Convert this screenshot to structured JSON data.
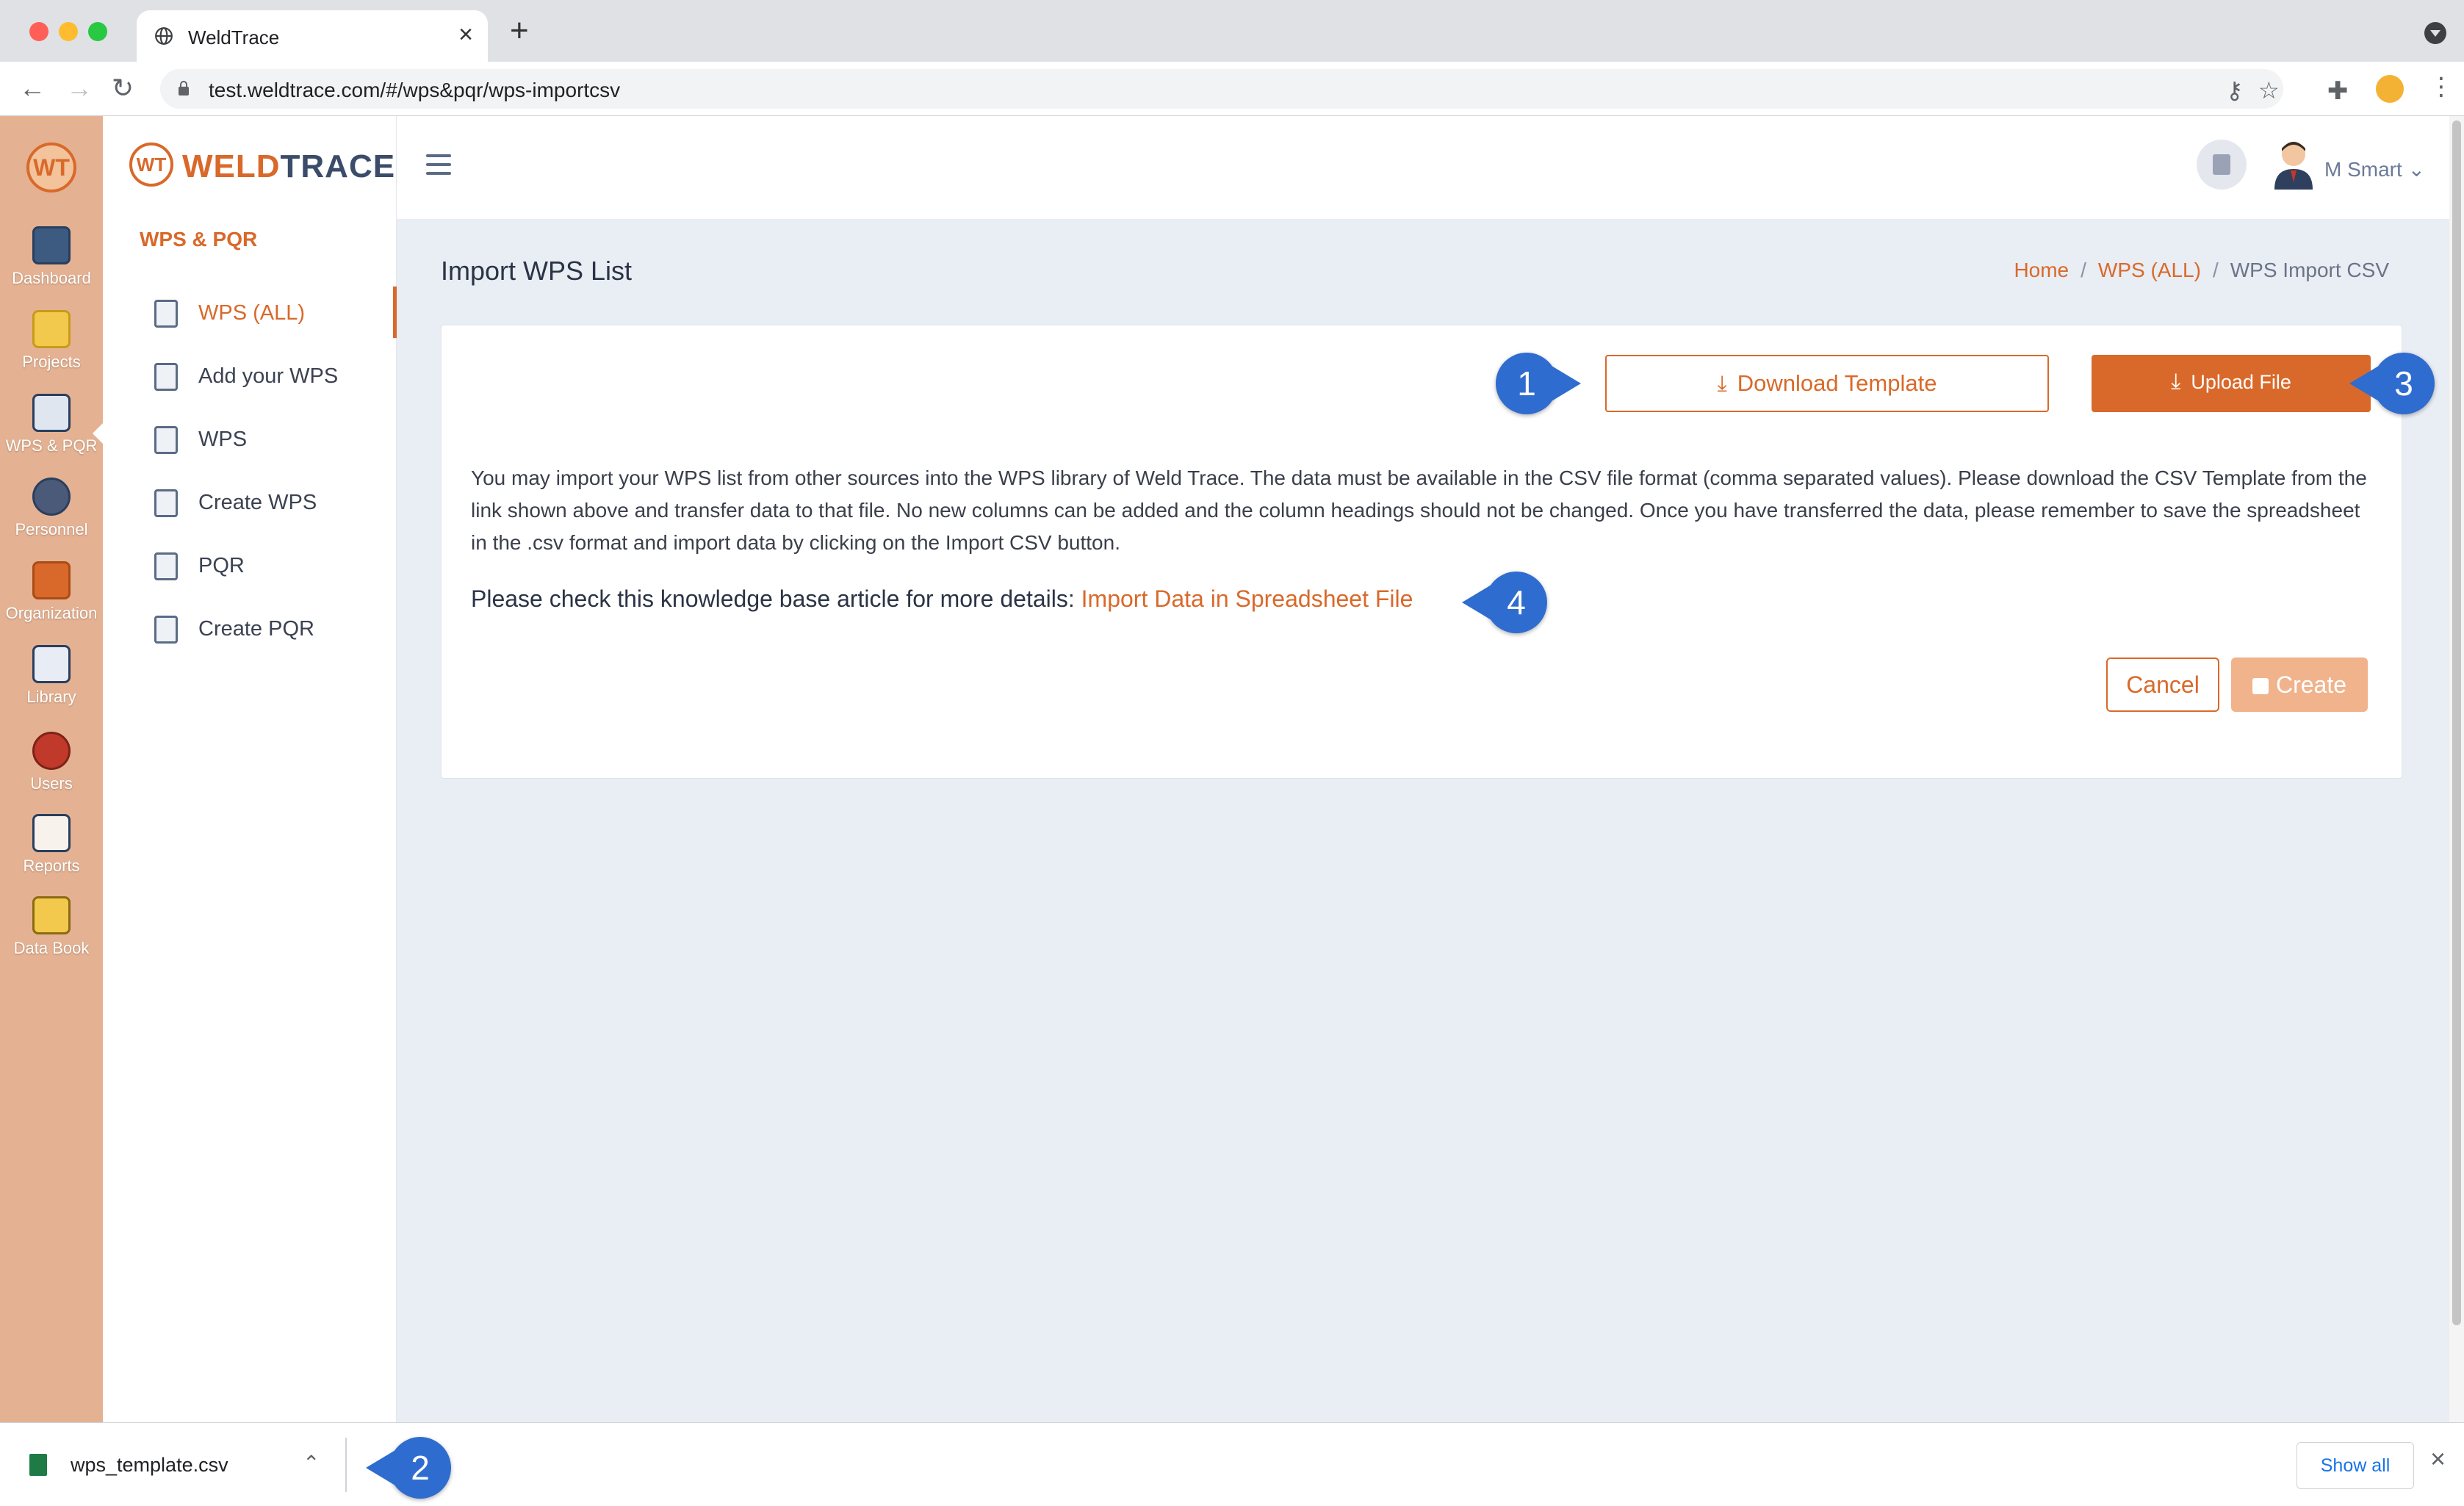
{
  "browser": {
    "tab_title": "WeldTrace",
    "new_tab": "+",
    "tab_close": "×",
    "url": "test.weldtrace.com/#/wps&pqr/wps-importcsv"
  },
  "rail": {
    "logo": "WT",
    "items": [
      {
        "label": "Dashboard",
        "icon": "dashboard-icon"
      },
      {
        "label": "Projects",
        "icon": "projects-icon"
      },
      {
        "label": "WPS & PQR",
        "icon": "wps-pqr-icon"
      },
      {
        "label": "Personnel",
        "icon": "personnel-icon"
      },
      {
        "label": "Organization",
        "icon": "organization-icon"
      },
      {
        "label": "Library",
        "icon": "library-icon"
      },
      {
        "label": "Users",
        "icon": "users-icon"
      },
      {
        "label": "Reports",
        "icon": "reports-icon"
      },
      {
        "label": "Data Book",
        "icon": "data-book-icon"
      }
    ],
    "active": "WPS & PQR"
  },
  "sidebar": {
    "brand_mark": "WT",
    "brand_weld": "WELD",
    "brand_trace": "TRACE",
    "section_title": "WPS & PQR",
    "items": [
      {
        "label": "WPS (ALL)"
      },
      {
        "label": "Add your WPS"
      },
      {
        "label": "WPS"
      },
      {
        "label": "Create WPS"
      },
      {
        "label": "PQR"
      },
      {
        "label": "Create PQR"
      }
    ],
    "active": "WPS (ALL)"
  },
  "topbar": {
    "user_name": "M Smart",
    "user_chevron": "⌄"
  },
  "page": {
    "title": "Import WPS List",
    "breadcrumb": {
      "home": "Home",
      "section": "WPS (ALL)",
      "current": "WPS Import CSV",
      "separator": "/"
    },
    "download_template_label": "Download Template",
    "upload_file_label": "Upload File",
    "description": "You may import your WPS list from other sources into the WPS library of Weld Trace. The data must be available in the CSV file format (comma separated values). Please download the CSV Template from the link shown above and transfer data to that file. No new columns can be added and the column headings should not be changed. Once you have transferred the data, please remember to save the spreadsheet in the .csv format and import data by clicking on the Import CSV button.",
    "kb_prefix": "Please check this knowledge base article for more details: ",
    "kb_link": "Import Data in Spreadsheet File",
    "cancel_label": "Cancel",
    "create_label": "Create"
  },
  "callouts": [
    "1",
    "2",
    "3",
    "4"
  ],
  "download_bar": {
    "file_name": "wps_template.csv",
    "show_all": "Show all"
  },
  "colors": {
    "accent": "#d9692a",
    "rail": "#e4b292",
    "callout": "#2f6ccf"
  }
}
